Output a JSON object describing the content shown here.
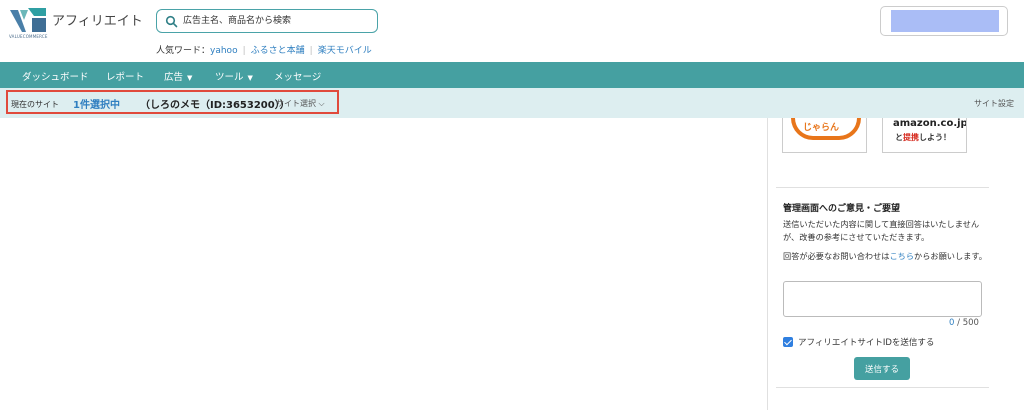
{
  "header": {
    "brand": "アフィリエイト",
    "logo_sub": "VALUECOMMERCE",
    "search_placeholder": "広告主名、商品名から検索",
    "popular_label": "人気ワード：",
    "popular_words": [
      "yahoo",
      "ふるさと本舗",
      "楽天モバイル"
    ]
  },
  "nav": {
    "items": [
      {
        "label": "ダッシュボード",
        "dropdown": false
      },
      {
        "label": "レポート",
        "dropdown": false
      },
      {
        "label": "広告",
        "dropdown": true
      },
      {
        "label": "ツール",
        "dropdown": true
      },
      {
        "label": "メッセージ",
        "dropdown": false
      }
    ]
  },
  "sitebar": {
    "label": "現在のサイト",
    "selected": "1件選択中",
    "site_name": "（しろのメモ（ID:3653200））",
    "select_label": "サイト選択",
    "settings_label": "サイト設定"
  },
  "banners": {
    "jalan_text": "じゃらん",
    "amazon_line1": "amazon.co.jp",
    "amazon_line2_pre": "と",
    "amazon_line2_red": "提携",
    "amazon_line2_post": "しよう！"
  },
  "feedback": {
    "title": "管理画面へのご意見・ご要望",
    "desc": "送信いただいた内容に関して直接回答はいたしませんが、改善の参考にさせていただきます。",
    "note_pre": "回答が必要なお問い合わせは",
    "note_link": "こちら",
    "note_post": "からお願いします。",
    "counter_current": "0",
    "counter_max": " / 500",
    "checkbox_label": "アフィリエイトサイトIDを送信する",
    "checkbox_checked": true,
    "submit_label": "送信する"
  },
  "colors": {
    "primary": "#45a0a1",
    "link": "#2f7fc0",
    "highlight": "#e04a3c",
    "sitebar_bg": "#ddeef0"
  }
}
